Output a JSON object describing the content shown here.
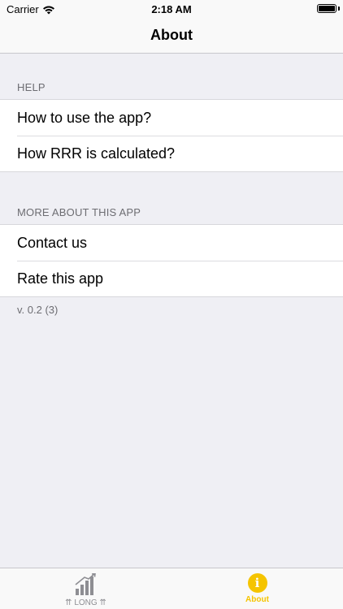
{
  "status_bar": {
    "carrier": "Carrier",
    "time": "2:18 AM",
    "wifi_icon": "wifi-icon",
    "battery_icon": "battery-icon"
  },
  "nav": {
    "title": "About"
  },
  "sections": [
    {
      "header": "HELP",
      "items": [
        {
          "label": "How to use the app?"
        },
        {
          "label": "How RRR is calculated?"
        }
      ]
    },
    {
      "header": "MORE ABOUT THIS APP",
      "items": [
        {
          "label": "Contact us"
        },
        {
          "label": "Rate this app"
        }
      ]
    }
  ],
  "version": "v. 0.2 (3)",
  "tab_bar": {
    "tabs": [
      {
        "label": "⇈ LONG ⇈",
        "icon": "bar-chart-icon",
        "active": false
      },
      {
        "label": "About",
        "icon": "info-icon",
        "active": true
      }
    ],
    "accent": "#f5c400",
    "inactive_color": "#8e8e93"
  }
}
